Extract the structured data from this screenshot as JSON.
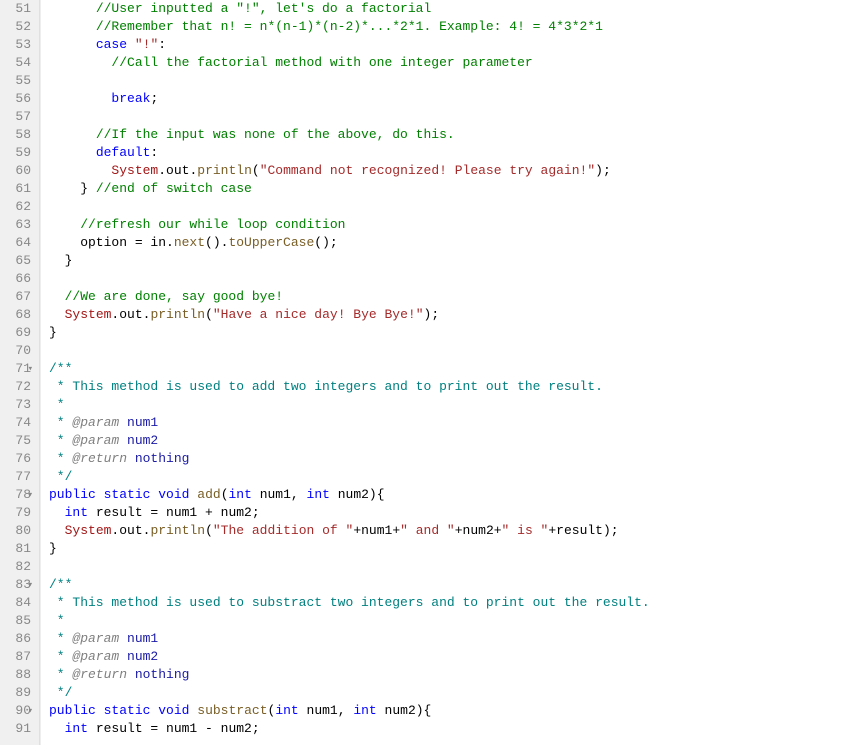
{
  "editor": {
    "startLine": 51,
    "foldLines": [
      71,
      78,
      83,
      90
    ],
    "lines": [
      {
        "n": 51,
        "tokens": [
          {
            "t": "      ",
            "c": ""
          },
          {
            "t": "//User inputted a \"!\", let's do a factorial",
            "c": "c-comment"
          }
        ]
      },
      {
        "n": 52,
        "tokens": [
          {
            "t": "      ",
            "c": ""
          },
          {
            "t": "//Remember that n! = n*(n-1)*(n-2)*...*2*1. Example: 4! = 4*3*2*1",
            "c": "c-comment"
          }
        ]
      },
      {
        "n": 53,
        "tokens": [
          {
            "t": "      ",
            "c": ""
          },
          {
            "t": "case",
            "c": "c-kw2"
          },
          {
            "t": " ",
            "c": ""
          },
          {
            "t": "\"!\"",
            "c": "c-string"
          },
          {
            "t": ":",
            "c": ""
          }
        ]
      },
      {
        "n": 54,
        "tokens": [
          {
            "t": "        ",
            "c": ""
          },
          {
            "t": "//Call the factorial method with one integer parameter",
            "c": "c-comment"
          }
        ]
      },
      {
        "n": 55,
        "tokens": [
          {
            "t": "",
            "c": ""
          }
        ]
      },
      {
        "n": 56,
        "tokens": [
          {
            "t": "        ",
            "c": ""
          },
          {
            "t": "break",
            "c": "c-kw2"
          },
          {
            "t": ";",
            "c": ""
          }
        ]
      },
      {
        "n": 57,
        "tokens": [
          {
            "t": "",
            "c": ""
          }
        ]
      },
      {
        "n": 58,
        "tokens": [
          {
            "t": "      ",
            "c": ""
          },
          {
            "t": "//If the input was none of the above, do this.",
            "c": "c-comment"
          }
        ]
      },
      {
        "n": 59,
        "tokens": [
          {
            "t": "      ",
            "c": ""
          },
          {
            "t": "default",
            "c": "c-kw2"
          },
          {
            "t": ":",
            "c": ""
          }
        ]
      },
      {
        "n": 60,
        "tokens": [
          {
            "t": "        ",
            "c": ""
          },
          {
            "t": "System",
            "c": "c-class"
          },
          {
            "t": ".",
            "c": "c-dot"
          },
          {
            "t": "out",
            "c": "c-var"
          },
          {
            "t": ".",
            "c": "c-dot"
          },
          {
            "t": "println",
            "c": "c-method"
          },
          {
            "t": "(",
            "c": ""
          },
          {
            "t": "\"Command not recognized! Please try again!\"",
            "c": "c-string"
          },
          {
            "t": ");",
            "c": ""
          }
        ]
      },
      {
        "n": 61,
        "tokens": [
          {
            "t": "    } ",
            "c": ""
          },
          {
            "t": "//end of switch case",
            "c": "c-comment"
          }
        ]
      },
      {
        "n": 62,
        "tokens": [
          {
            "t": "",
            "c": ""
          }
        ]
      },
      {
        "n": 63,
        "tokens": [
          {
            "t": "    ",
            "c": ""
          },
          {
            "t": "//refresh our while loop condition",
            "c": "c-comment"
          }
        ]
      },
      {
        "n": 64,
        "tokens": [
          {
            "t": "    option = in.",
            "c": ""
          },
          {
            "t": "next",
            "c": "c-method"
          },
          {
            "t": "().",
            "c": ""
          },
          {
            "t": "toUpperCase",
            "c": "c-method"
          },
          {
            "t": "();",
            "c": ""
          }
        ]
      },
      {
        "n": 65,
        "tokens": [
          {
            "t": "  }",
            "c": ""
          }
        ]
      },
      {
        "n": 66,
        "tokens": [
          {
            "t": "",
            "c": ""
          }
        ]
      },
      {
        "n": 67,
        "tokens": [
          {
            "t": "  ",
            "c": ""
          },
          {
            "t": "//We are done, say good bye!",
            "c": "c-comment"
          }
        ]
      },
      {
        "n": 68,
        "tokens": [
          {
            "t": "  ",
            "c": ""
          },
          {
            "t": "System",
            "c": "c-class"
          },
          {
            "t": ".",
            "c": "c-dot"
          },
          {
            "t": "out",
            "c": "c-var"
          },
          {
            "t": ".",
            "c": "c-dot"
          },
          {
            "t": "println",
            "c": "c-method"
          },
          {
            "t": "(",
            "c": ""
          },
          {
            "t": "\"Have a nice day! Bye Bye!\"",
            "c": "c-string"
          },
          {
            "t": ");",
            "c": ""
          }
        ]
      },
      {
        "n": 69,
        "tokens": [
          {
            "t": "}",
            "c": ""
          }
        ]
      },
      {
        "n": 70,
        "tokens": [
          {
            "t": "",
            "c": ""
          }
        ]
      },
      {
        "n": 71,
        "tokens": [
          {
            "t": "/**",
            "c": "c-jdoc"
          }
        ]
      },
      {
        "n": 72,
        "tokens": [
          {
            "t": " * This method is used to add two integers and to print out the result.",
            "c": "c-jdoc"
          }
        ]
      },
      {
        "n": 73,
        "tokens": [
          {
            "t": " *",
            "c": "c-jdoc"
          }
        ]
      },
      {
        "n": 74,
        "tokens": [
          {
            "t": " * ",
            "c": "c-jdoc"
          },
          {
            "t": "@param",
            "c": "c-jdoc-tag"
          },
          {
            "t": " ",
            "c": ""
          },
          {
            "t": "num1",
            "c": "c-jdoc-param"
          }
        ]
      },
      {
        "n": 75,
        "tokens": [
          {
            "t": " * ",
            "c": "c-jdoc"
          },
          {
            "t": "@param",
            "c": "c-jdoc-tag"
          },
          {
            "t": " ",
            "c": ""
          },
          {
            "t": "num2",
            "c": "c-jdoc-param"
          }
        ]
      },
      {
        "n": 76,
        "tokens": [
          {
            "t": " * ",
            "c": "c-jdoc"
          },
          {
            "t": "@return",
            "c": "c-jdoc-tag"
          },
          {
            "t": " ",
            "c": ""
          },
          {
            "t": "nothing",
            "c": "c-jdoc-param"
          }
        ]
      },
      {
        "n": 77,
        "tokens": [
          {
            "t": " */",
            "c": "c-jdoc"
          }
        ]
      },
      {
        "n": 78,
        "tokens": [
          {
            "t": "public",
            "c": "c-kw2"
          },
          {
            "t": " ",
            "c": ""
          },
          {
            "t": "static",
            "c": "c-kw2"
          },
          {
            "t": " ",
            "c": ""
          },
          {
            "t": "void",
            "c": "c-kw2"
          },
          {
            "t": " ",
            "c": ""
          },
          {
            "t": "add",
            "c": "c-method"
          },
          {
            "t": "(",
            "c": ""
          },
          {
            "t": "int",
            "c": "c-kw2"
          },
          {
            "t": " num1, ",
            "c": ""
          },
          {
            "t": "int",
            "c": "c-kw2"
          },
          {
            "t": " num2){",
            "c": ""
          }
        ]
      },
      {
        "n": 79,
        "tokens": [
          {
            "t": "  ",
            "c": ""
          },
          {
            "t": "int",
            "c": "c-kw2"
          },
          {
            "t": " result = num1 + num2;",
            "c": ""
          }
        ]
      },
      {
        "n": 80,
        "tokens": [
          {
            "t": "  ",
            "c": ""
          },
          {
            "t": "System",
            "c": "c-class"
          },
          {
            "t": ".",
            "c": "c-dot"
          },
          {
            "t": "out",
            "c": "c-var"
          },
          {
            "t": ".",
            "c": "c-dot"
          },
          {
            "t": "println",
            "c": "c-method"
          },
          {
            "t": "(",
            "c": ""
          },
          {
            "t": "\"The addition of \"",
            "c": "c-string"
          },
          {
            "t": "+num1+",
            "c": ""
          },
          {
            "t": "\" and \"",
            "c": "c-string"
          },
          {
            "t": "+num2+",
            "c": ""
          },
          {
            "t": "\" is \"",
            "c": "c-string"
          },
          {
            "t": "+result);",
            "c": ""
          }
        ]
      },
      {
        "n": 81,
        "tokens": [
          {
            "t": "}",
            "c": ""
          }
        ]
      },
      {
        "n": 82,
        "tokens": [
          {
            "t": "",
            "c": ""
          }
        ]
      },
      {
        "n": 83,
        "tokens": [
          {
            "t": "/**",
            "c": "c-jdoc"
          }
        ]
      },
      {
        "n": 84,
        "tokens": [
          {
            "t": " * This method is used to substract two integers and to print out the result.",
            "c": "c-jdoc"
          }
        ]
      },
      {
        "n": 85,
        "tokens": [
          {
            "t": " *",
            "c": "c-jdoc"
          }
        ]
      },
      {
        "n": 86,
        "tokens": [
          {
            "t": " * ",
            "c": "c-jdoc"
          },
          {
            "t": "@param",
            "c": "c-jdoc-tag"
          },
          {
            "t": " ",
            "c": ""
          },
          {
            "t": "num1",
            "c": "c-jdoc-param"
          }
        ]
      },
      {
        "n": 87,
        "tokens": [
          {
            "t": " * ",
            "c": "c-jdoc"
          },
          {
            "t": "@param",
            "c": "c-jdoc-tag"
          },
          {
            "t": " ",
            "c": ""
          },
          {
            "t": "num2",
            "c": "c-jdoc-param"
          }
        ]
      },
      {
        "n": 88,
        "tokens": [
          {
            "t": " * ",
            "c": "c-jdoc"
          },
          {
            "t": "@return",
            "c": "c-jdoc-tag"
          },
          {
            "t": " ",
            "c": ""
          },
          {
            "t": "nothing",
            "c": "c-jdoc-param"
          }
        ]
      },
      {
        "n": 89,
        "tokens": [
          {
            "t": " */",
            "c": "c-jdoc"
          }
        ]
      },
      {
        "n": 90,
        "tokens": [
          {
            "t": "public",
            "c": "c-kw2"
          },
          {
            "t": " ",
            "c": ""
          },
          {
            "t": "static",
            "c": "c-kw2"
          },
          {
            "t": " ",
            "c": ""
          },
          {
            "t": "void",
            "c": "c-kw2"
          },
          {
            "t": " ",
            "c": ""
          },
          {
            "t": "substract",
            "c": "c-method"
          },
          {
            "t": "(",
            "c": ""
          },
          {
            "t": "int",
            "c": "c-kw2"
          },
          {
            "t": " num1, ",
            "c": ""
          },
          {
            "t": "int",
            "c": "c-kw2"
          },
          {
            "t": " num2){",
            "c": ""
          }
        ]
      },
      {
        "n": 91,
        "tokens": [
          {
            "t": "  ",
            "c": ""
          },
          {
            "t": "int",
            "c": "c-kw2"
          },
          {
            "t": " result = num1 - num2;",
            "c": ""
          }
        ]
      }
    ]
  }
}
